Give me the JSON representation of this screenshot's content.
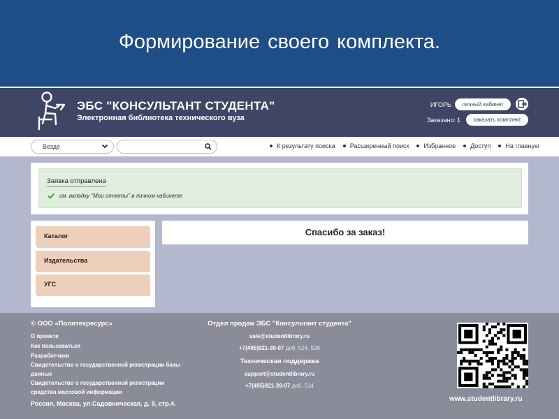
{
  "slide": {
    "title": "Формирование  своего  комплекта."
  },
  "header": {
    "brand_name": "ЭБС \"КОНСУЛЬТАНТ СТУДЕНТА\"",
    "brand_subtitle": "Электронная библиотека технического вуза",
    "user_name": "ИГОРЬ",
    "cabinet_button": "личный кабинет",
    "ordered_label": "Заказано:",
    "ordered_count": "1",
    "order_button": "заказать комплект"
  },
  "search": {
    "scope_selected": "Везде",
    "query": "",
    "nav_links": [
      "К результату поиска",
      "Расширенный поиск",
      "Избранное",
      "Доступ",
      "На главную"
    ]
  },
  "notice": {
    "title": "Заявка отправлена",
    "text": "см. вкладку \"Мои отчеты\" в личном кабинете"
  },
  "sidebar": {
    "items": [
      {
        "label": "Каталог"
      },
      {
        "label": "Издательства"
      },
      {
        "label": "УГС"
      }
    ]
  },
  "main": {
    "thanks": "Спасибо за заказ!"
  },
  "footer": {
    "copyright": "© ООО «Политехресурс»",
    "links": [
      "О проекте",
      "Как пользоваться",
      "Разработчики",
      "Свидетельство о государственной регистрации базы",
      "данных",
      "Свидетельство о государственной регистрации",
      "средства массовой информации"
    ],
    "address": "Россия, Москва, ул.Садовническая, д. 9, стр.4.",
    "sales_title": "Отдел продаж ЭБС \"Консультант студента\"",
    "sales_email": "sale@studentlibrary.ru",
    "sales_phone": "+7(495)921-39-07",
    "sales_ext": "доб. 524, 526",
    "support_title": "Техническая поддержка",
    "support_email": "support@studentlibrary.ru",
    "support_phone": "+7(495)921-39-07",
    "support_ext": "доб. 514",
    "site_url": "www.studentlibrary.ru"
  },
  "colors": {
    "slide_bg": "#1f4e86",
    "header_bg": "#3f4565",
    "content_bg": "#b4b8cf",
    "notice_bg": "#dfeedd",
    "sidebar_item_bg": "#eecfba",
    "footer_bg": "#8a8c99",
    "check": "#4a9a3e"
  },
  "icons": [
    "logo-figure-icon",
    "logout-icon",
    "chevron-down-icon",
    "search-icon",
    "check-icon",
    "qr-code-icon"
  ]
}
